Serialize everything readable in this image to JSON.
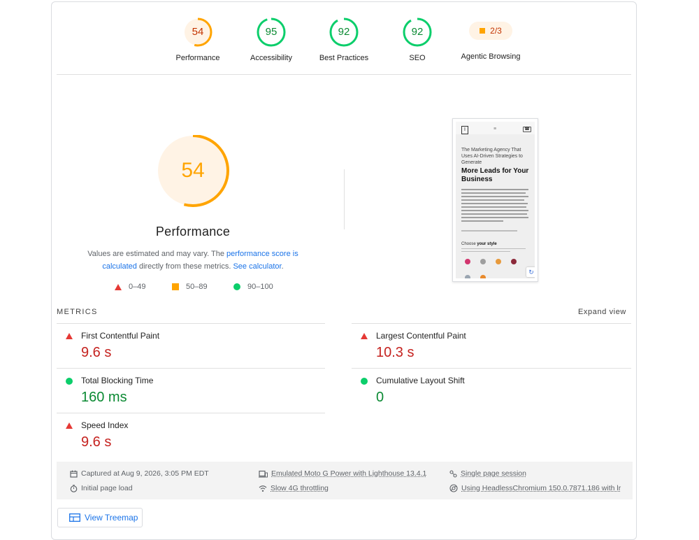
{
  "gauges": [
    {
      "score": "54",
      "label": "Performance",
      "color": "#ffa400",
      "bg": "#fff3e5",
      "fraction": 0.54
    },
    {
      "score": "95",
      "label": "Accessibility",
      "color": "#0cce6b",
      "bg": "#ffffff",
      "fraction": 0.95
    },
    {
      "score": "92",
      "label": "Best Practices",
      "color": "#0cce6b",
      "bg": "#ffffff",
      "fraction": 0.92
    },
    {
      "score": "92",
      "label": "SEO",
      "color": "#0cce6b",
      "bg": "#ffffff",
      "fraction": 0.92
    }
  ],
  "agentic": {
    "value": "2/3",
    "label": "Agentic Browsing"
  },
  "performance": {
    "score": "54",
    "fraction": 0.54,
    "title": "Performance",
    "desc_a": "Values are estimated and may vary. The ",
    "link_score": "performance score is calculated",
    "desc_b": " directly from these metrics. ",
    "link_calc": "See calculator",
    "desc_c": "."
  },
  "legend": {
    "poor": "0–49",
    "average": "50–89",
    "good": "90–100"
  },
  "screenshot": {
    "subtitle": "The Marketing Agency That Uses AI-Driven Strategies to Generate",
    "headline": "More Leads for Your Business",
    "choose_a": "Choose",
    "choose_b": "your style"
  },
  "metrics": {
    "label": "METRICS",
    "expand": "Expand view",
    "items": [
      {
        "name": "First Contentful Paint",
        "value": "9.6 s",
        "status": "poor"
      },
      {
        "name": "Largest Contentful Paint",
        "value": "10.3 s",
        "status": "poor"
      },
      {
        "name": "Total Blocking Time",
        "value": "160 ms",
        "status": "good"
      },
      {
        "name": "Cumulative Layout Shift",
        "value": "0",
        "status": "good"
      },
      {
        "name": "Speed Index",
        "value": "9.6 s",
        "status": "poor"
      }
    ]
  },
  "footer": {
    "captured": "Captured at Aug 9, 2026, 3:05 PM EDT",
    "initial": "Initial page load",
    "device": "Emulated Moto G Power with Lighthouse 13.4.1",
    "throttling": "Slow 4G throttling",
    "session": "Single page session",
    "browser": "Using HeadlessChromium 150.0.7871.186 with lr"
  },
  "treemap": {
    "label": "View Treemap"
  },
  "colors": {
    "poor": "#e53935",
    "average": "#ffa400",
    "good": "#0cce6b",
    "link": "#1a73e8"
  }
}
